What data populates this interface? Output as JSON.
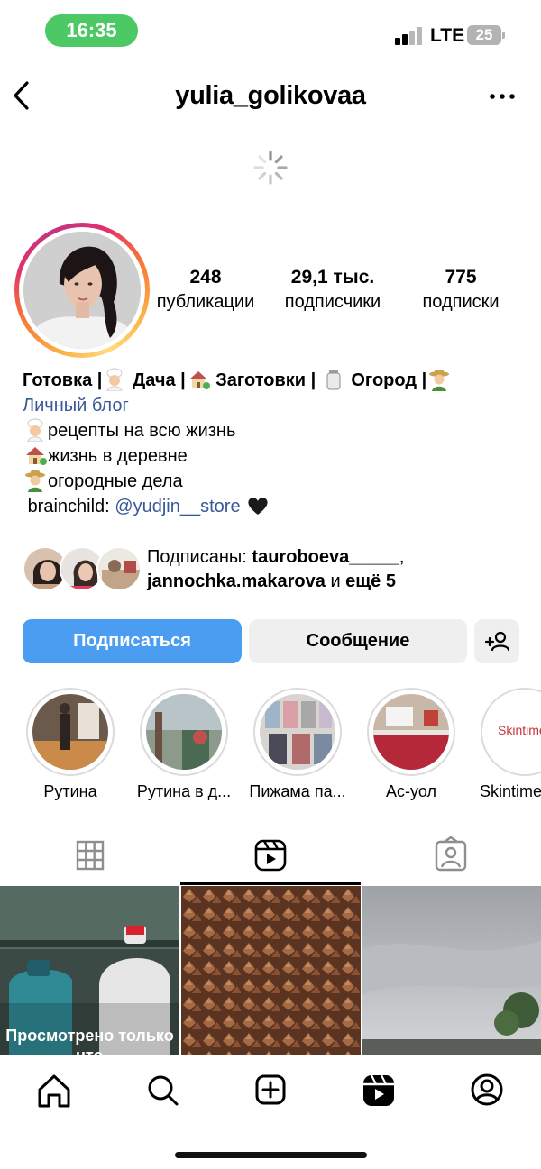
{
  "status_bar": {
    "time": "16:35",
    "network": "LTE",
    "battery": "25"
  },
  "header": {
    "username": "yulia_golikovaa",
    "back_icon": "chevron-left-icon",
    "more_icon": "more-horizontal-icon"
  },
  "profile": {
    "stats": [
      {
        "value": "248",
        "label": "публикации"
      },
      {
        "value": "29,1 тыс.",
        "label": "подписчики"
      },
      {
        "value": "775",
        "label": "подписки"
      }
    ],
    "bio": {
      "title_parts": [
        "Готовка |",
        "Дача |",
        "Заготовки |",
        "Огород |"
      ],
      "category": "Личный блог",
      "lines": [
        "рецепты на всю жизнь",
        "жизнь в деревне",
        "огородные дела"
      ],
      "link_prefix": "brainchild:",
      "link": "@yudjin__store"
    },
    "followed_by": {
      "prefix": "Подписаны:",
      "user1": "tauroboeva_____",
      "sep": ",",
      "user2": "jannochka.makarova",
      "and": "и",
      "more": "ещё 5"
    }
  },
  "actions": {
    "follow": "Подписаться",
    "message": "Сообщение"
  },
  "highlights": [
    {
      "label": "Рутина"
    },
    {
      "label": "Рутина в д..."
    },
    {
      "label": "Пижама па..."
    },
    {
      "label": "Ас-уол"
    },
    {
      "label": "Skintime",
      "cover_text": "Skintime"
    }
  ],
  "tabs": [
    {
      "name": "grid-icon",
      "active": false
    },
    {
      "name": "reels-icon",
      "active": true
    },
    {
      "name": "tagged-icon",
      "active": false
    }
  ],
  "grid": {
    "watched_label": "Просмотрено только что"
  },
  "bottom_nav": [
    "home-icon",
    "search-icon",
    "create-icon",
    "reels-icon",
    "profile-icon"
  ],
  "colors": {
    "primary_button": "#4a9df1",
    "link": "#385898",
    "status_time_pill": "#4cc864"
  }
}
